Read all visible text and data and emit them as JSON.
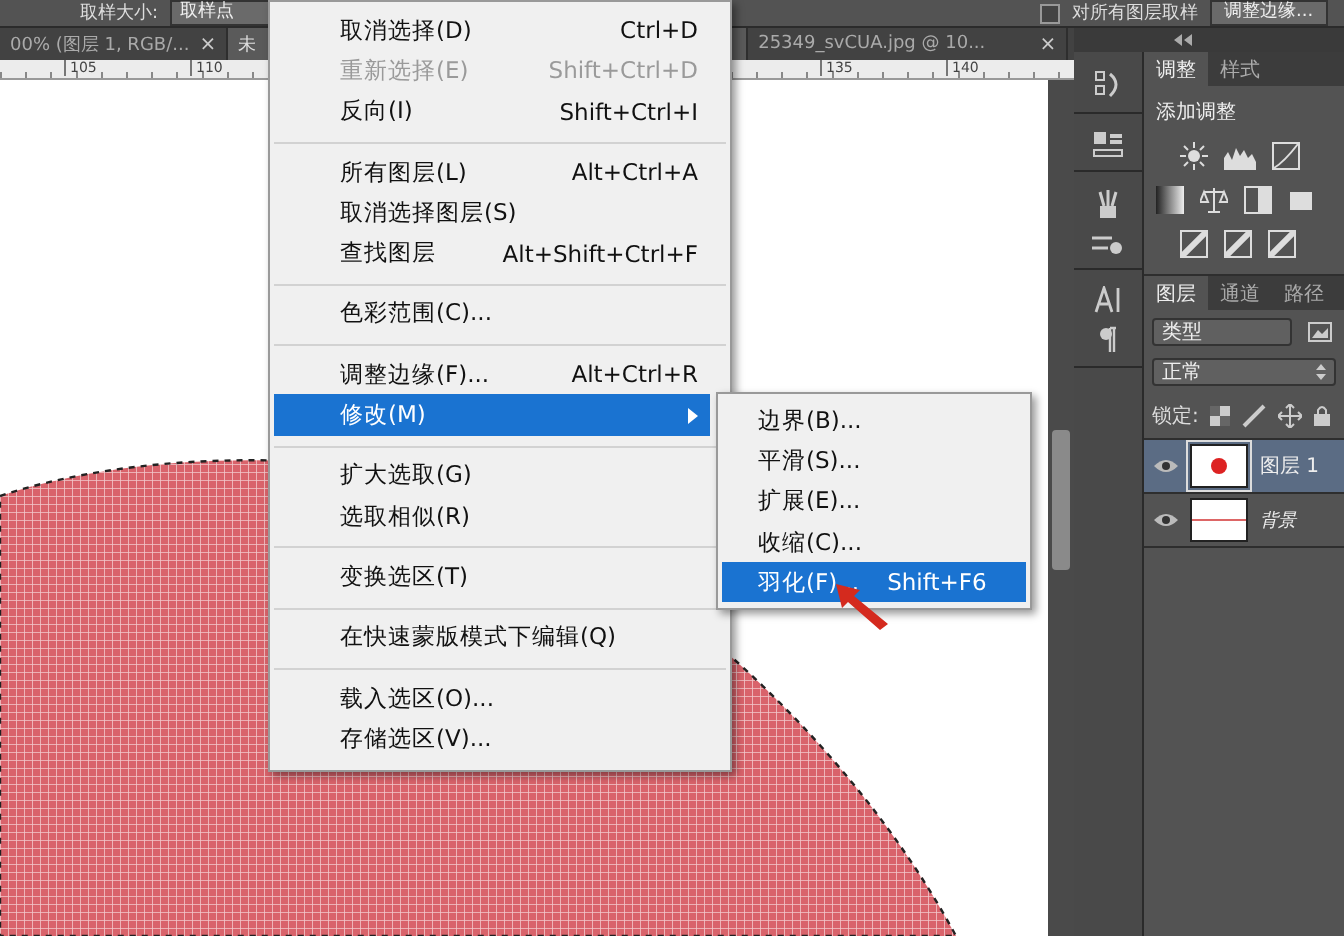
{
  "options_bar": {
    "sample_size_label": "取样大小:",
    "sample_size_value": "取样点",
    "all_layers": {
      "label": "对所有图层取样",
      "checked": false
    },
    "refine_button": "调整边缘..."
  },
  "document_tabs": [
    {
      "label": "00% (图层 1, RGB/...",
      "close": "×",
      "selected": false
    },
    {
      "label": "未",
      "selected": true
    },
    {
      "label": "25349_svCUA.jpg @ 10...",
      "close": "×",
      "selected": false
    }
  ],
  "ruler": [
    "105",
    "110",
    "135",
    "140"
  ],
  "menu": [
    {
      "kind": "item",
      "label": "取消选择(D)",
      "shortcut": "Ctrl+D",
      "disabled": false,
      "selected": false
    },
    {
      "kind": "item",
      "label": "重新选择(E)",
      "shortcut": "Shift+Ctrl+D",
      "disabled": true,
      "selected": false
    },
    {
      "kind": "item",
      "label": "反向(I)",
      "shortcut": "Shift+Ctrl+I",
      "disabled": false,
      "selected": false
    },
    {
      "kind": "separator"
    },
    {
      "kind": "item",
      "label": "所有图层(L)",
      "shortcut": "Alt+Ctrl+A",
      "disabled": false,
      "selected": false
    },
    {
      "kind": "item",
      "label": "取消选择图层(S)",
      "disabled": false,
      "selected": false
    },
    {
      "kind": "item",
      "label": "查找图层",
      "shortcut": "Alt+Shift+Ctrl+F",
      "disabled": false,
      "selected": false
    },
    {
      "kind": "separator"
    },
    {
      "kind": "item",
      "label": "色彩范围(C)...",
      "disabled": false,
      "selected": false
    },
    {
      "kind": "separator"
    },
    {
      "kind": "item",
      "label": "调整边缘(F)...",
      "shortcut": "Alt+Ctrl+R",
      "disabled": false,
      "selected": false
    },
    {
      "kind": "item",
      "label": "修改(M)",
      "submenu": true,
      "disabled": false,
      "selected": true
    },
    {
      "kind": "separator"
    },
    {
      "kind": "item",
      "label": "扩大选取(G)",
      "disabled": false,
      "selected": false
    },
    {
      "kind": "item",
      "label": "选取相似(R)",
      "disabled": false,
      "selected": false
    },
    {
      "kind": "separator"
    },
    {
      "kind": "item",
      "label": "变换选区(T)",
      "disabled": false,
      "selected": false
    },
    {
      "kind": "separator"
    },
    {
      "kind": "item",
      "label": "在快速蒙版模式下编辑(Q)",
      "disabled": false,
      "selected": false
    },
    {
      "kind": "separator"
    },
    {
      "kind": "item",
      "label": "载入选区(O)...",
      "disabled": false,
      "selected": false
    },
    {
      "kind": "item",
      "label": "存储选区(V)...",
      "disabled": false,
      "selected": false
    }
  ],
  "submenu": [
    {
      "label": "边界(B)...",
      "selected": false
    },
    {
      "label": "平滑(S)...",
      "selected": false
    },
    {
      "label": "扩展(E)...",
      "selected": false
    },
    {
      "label": "收缩(C)...",
      "selected": false
    },
    {
      "label": "羽化(F)...",
      "shortcut": "Shift+F6",
      "selected": true
    }
  ],
  "adjustments_panel": {
    "tabs": [
      {
        "label": "调整",
        "selected": true
      },
      {
        "label": "样式",
        "selected": false
      }
    ],
    "heading": "添加调整"
  },
  "layers_panel": {
    "tabs": [
      {
        "label": "图层",
        "selected": true
      },
      {
        "label": "通道",
        "selected": false
      },
      {
        "label": "路径",
        "selected": false
      }
    ],
    "filter": "类型",
    "blend_mode": "正常",
    "lock_label": "锁定:",
    "layers": [
      {
        "name": "图层 1",
        "kind": "dot",
        "selected": true,
        "visible": true
      },
      {
        "name": "背景",
        "kind": "line",
        "selected": false,
        "visible": true
      }
    ]
  }
}
